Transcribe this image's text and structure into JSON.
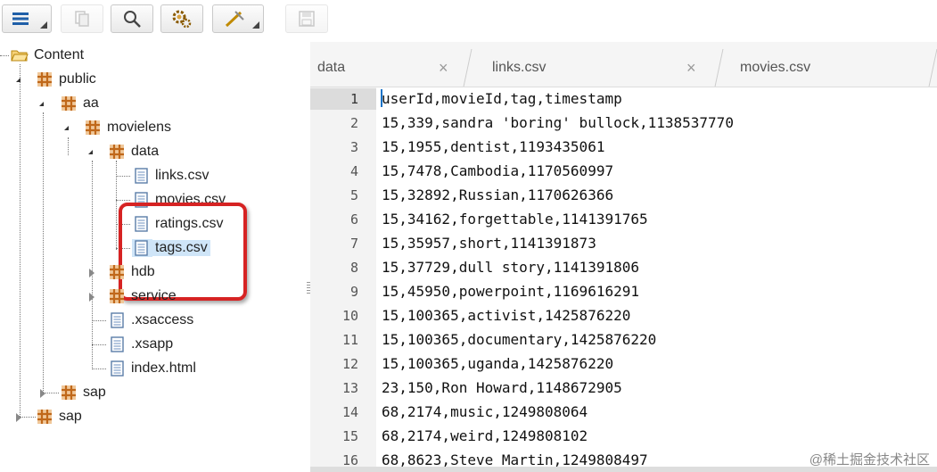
{
  "toolbar": {
    "buttons": [
      {
        "name": "menu",
        "icon": "hamburger-icon"
      },
      {
        "name": "copy",
        "icon": "copy-icon",
        "disabled": true
      },
      {
        "name": "search",
        "icon": "search-icon"
      },
      {
        "name": "settings",
        "icon": "gear-icon"
      },
      {
        "name": "run",
        "icon": "wand-icon"
      },
      {
        "name": "save",
        "icon": "save-icon",
        "disabled": true
      }
    ]
  },
  "tree": {
    "root": "Content",
    "public": "public",
    "aa": "aa",
    "movielens": "movielens",
    "data": "data",
    "files": [
      "links.csv",
      "movies.csv",
      "ratings.csv",
      "tags.csv"
    ],
    "selected_file": "tags.csv",
    "hdb": "hdb",
    "service": "service",
    "xsaccess": ".xsaccess",
    "xsapp": ".xsapp",
    "index": "index.html",
    "sap_inner": "sap",
    "sap_outer": "sap"
  },
  "tabs": [
    {
      "label": "data"
    },
    {
      "label": "links.csv"
    },
    {
      "label": "movies.csv"
    }
  ],
  "editor": {
    "lines": [
      {
        "no": "1",
        "text": "userId,movieId,tag,timestamp"
      },
      {
        "no": "2",
        "text": "15,339,sandra 'boring' bullock,1138537770"
      },
      {
        "no": "3",
        "text": "15,1955,dentist,1193435061"
      },
      {
        "no": "4",
        "text": "15,7478,Cambodia,1170560997"
      },
      {
        "no": "5",
        "text": "15,32892,Russian,1170626366"
      },
      {
        "no": "6",
        "text": "15,34162,forgettable,1141391765"
      },
      {
        "no": "7",
        "text": "15,35957,short,1141391873"
      },
      {
        "no": "8",
        "text": "15,37729,dull story,1141391806"
      },
      {
        "no": "9",
        "text": "15,45950,powerpoint,1169616291"
      },
      {
        "no": "10",
        "text": "15,100365,activist,1425876220"
      },
      {
        "no": "11",
        "text": "15,100365,documentary,1425876220"
      },
      {
        "no": "12",
        "text": "15,100365,uganda,1425876220"
      },
      {
        "no": "13",
        "text": "23,150,Ron Howard,1148672905"
      },
      {
        "no": "14",
        "text": "68,2174,music,1249808064"
      },
      {
        "no": "15",
        "text": "68,2174,weird,1249808102"
      },
      {
        "no": "16",
        "text": "68,8623,Steve Martin,1249808497"
      }
    ]
  },
  "watermark": "@稀土掘金技术社区",
  "colors": {
    "highlight": "#d62323",
    "selected": "#cfe5f8",
    "cursor": "#1a73c7",
    "package": "#c0681a"
  }
}
